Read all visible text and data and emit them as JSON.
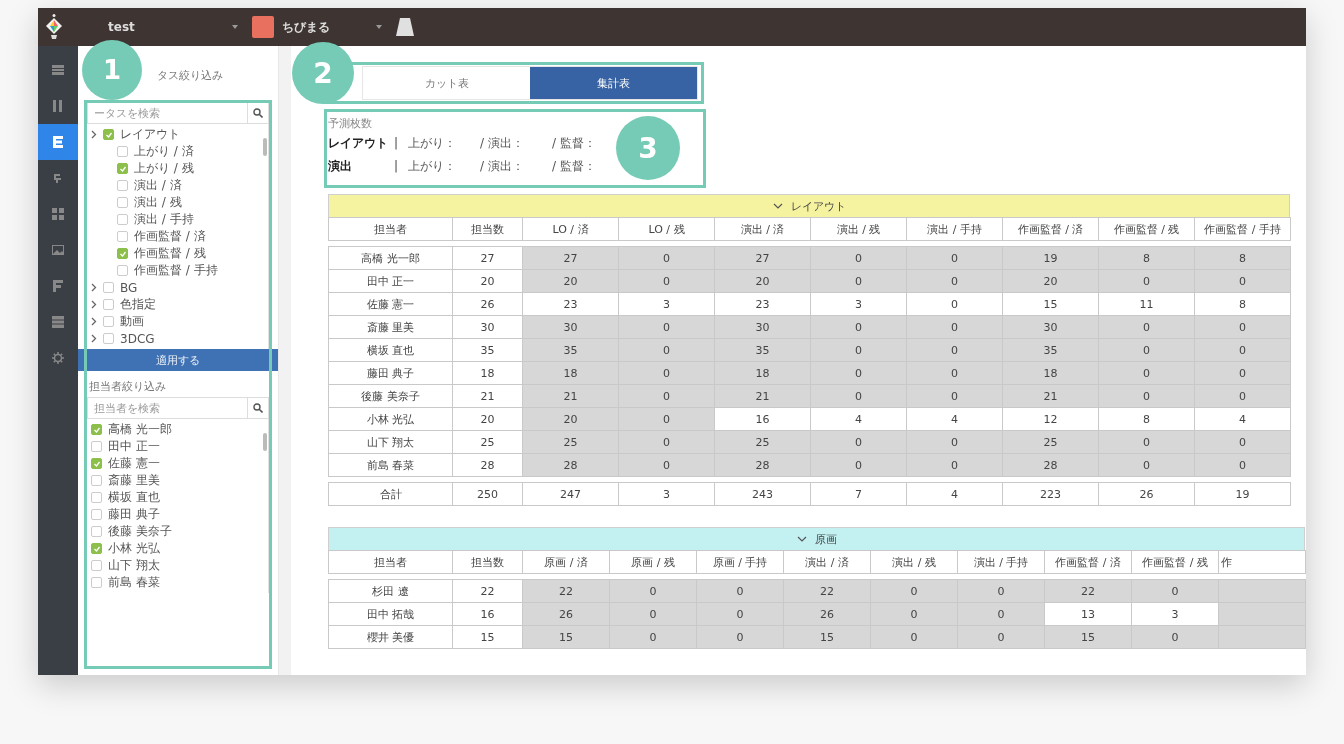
{
  "topbar": {
    "project": "test",
    "episode": "ちびまる"
  },
  "rail": [
    {
      "kind": "list",
      "selected": false
    },
    {
      "kind": "columns",
      "selected": false
    },
    {
      "kind": "sheet",
      "selected": true
    },
    {
      "kind": "steps",
      "selected": false
    },
    {
      "kind": "grid",
      "selected": false
    },
    {
      "kind": "image",
      "selected": false
    },
    {
      "kind": "flag",
      "selected": false
    },
    {
      "kind": "table",
      "selected": false
    },
    {
      "kind": "gear",
      "selected": false
    }
  ],
  "status_filter": {
    "callout": "1",
    "title": "タス絞り込み",
    "search_placeholder": "ータスを検索",
    "items": [
      {
        "label": "レイアウト",
        "checked": true,
        "children": [
          {
            "label": "上がり / 済",
            "checked": false
          },
          {
            "label": "上がり / 残",
            "checked": true
          },
          {
            "label": "演出 / 済",
            "checked": false
          },
          {
            "label": "演出 / 残",
            "checked": false
          },
          {
            "label": "演出 / 手持",
            "checked": false
          },
          {
            "label": "作画監督 / 済",
            "checked": false
          },
          {
            "label": "作画監督 / 残",
            "checked": true
          },
          {
            "label": "作画監督 / 手持",
            "checked": false
          }
        ]
      },
      {
        "label": "BG",
        "checked": false
      },
      {
        "label": "色指定",
        "checked": false
      },
      {
        "label": "動画",
        "checked": false
      },
      {
        "label": "3DCG",
        "checked": false
      }
    ],
    "apply_button": "適用する"
  },
  "person_filter": {
    "title": "担当者絞り込み",
    "search_placeholder": "担当者を検索",
    "people": [
      {
        "name": "高橋 光一郎",
        "checked": true
      },
      {
        "name": "田中 正一",
        "checked": false
      },
      {
        "name": "佐藤 憲一",
        "checked": true
      },
      {
        "name": "斎藤 里美",
        "checked": false
      },
      {
        "name": "横坂 直也",
        "checked": false
      },
      {
        "name": "藤田 典子",
        "checked": false
      },
      {
        "name": "後藤 美奈子",
        "checked": false
      },
      {
        "name": "小林 光弘",
        "checked": true
      },
      {
        "name": "山下 翔太",
        "checked": false
      },
      {
        "name": "前島 春菜",
        "checked": false
      }
    ]
  },
  "view_tabs": {
    "callout": "2",
    "tabs": [
      {
        "label": "カット表",
        "selected": false
      },
      {
        "label": "集計表",
        "selected": true
      }
    ]
  },
  "forecast": {
    "callout": "3",
    "title": "予測枚数",
    "rows": [
      {
        "label": "レイアウト",
        "separator": "|",
        "fields": [
          "上がり：",
          "/ 演出：",
          "/ 監督："
        ]
      },
      {
        "label": "演出",
        "separator": "|",
        "fields": [
          "上がり：",
          "/ 演出：",
          "/ 監督："
        ]
      }
    ]
  },
  "tables": [
    {
      "title": "レイアウト",
      "color": "#f6f3a0",
      "columns": [
        "担当者",
        "担当数",
        "LO / 済",
        "LO / 残",
        "演出 / 済",
        "演出 / 残",
        "演出 / 手持",
        "作画監督 / 済",
        "作画監督 / 残",
        "作画監督 / 手持"
      ],
      "rows": [
        {
          "cells": [
            {
              "value": "高橋 光一郎",
              "shaded": false
            },
            {
              "value": "27",
              "shaded": false
            },
            {
              "value": "27",
              "shaded": true
            },
            {
              "value": "0",
              "shaded": true
            },
            {
              "value": "27",
              "shaded": true
            },
            {
              "value": "0",
              "shaded": true
            },
            {
              "value": "0",
              "shaded": true
            },
            {
              "value": "19",
              "shaded": true
            },
            {
              "value": "8",
              "shaded": true
            },
            {
              "value": "8",
              "shaded": true
            }
          ]
        },
        {
          "cells": [
            {
              "value": "田中 正一",
              "shaded": false
            },
            {
              "value": "20",
              "shaded": false
            },
            {
              "value": "20",
              "shaded": true
            },
            {
              "value": "0",
              "shaded": true
            },
            {
              "value": "20",
              "shaded": true
            },
            {
              "value": "0",
              "shaded": true
            },
            {
              "value": "0",
              "shaded": true
            },
            {
              "value": "20",
              "shaded": true
            },
            {
              "value": "0",
              "shaded": true
            },
            {
              "value": "0",
              "shaded": true
            }
          ]
        },
        {
          "cells": [
            {
              "value": "佐藤 憲一",
              "shaded": false
            },
            {
              "value": "26",
              "shaded": false
            },
            {
              "value": "23",
              "shaded": false
            },
            {
              "value": "3",
              "shaded": false
            },
            {
              "value": "23",
              "shaded": false
            },
            {
              "value": "3",
              "shaded": false
            },
            {
              "value": "0",
              "shaded": false
            },
            {
              "value": "15",
              "shaded": false
            },
            {
              "value": "11",
              "shaded": false
            },
            {
              "value": "8",
              "shaded": false
            }
          ]
        },
        {
          "cells": [
            {
              "value": "斎藤 里美",
              "shaded": false
            },
            {
              "value": "30",
              "shaded": false
            },
            {
              "value": "30",
              "shaded": true
            },
            {
              "value": "0",
              "shaded": true
            },
            {
              "value": "30",
              "shaded": true
            },
            {
              "value": "0",
              "shaded": true
            },
            {
              "value": "0",
              "shaded": true
            },
            {
              "value": "30",
              "shaded": true
            },
            {
              "value": "0",
              "shaded": true
            },
            {
              "value": "0",
              "shaded": true
            }
          ]
        },
        {
          "cells": [
            {
              "value": "横坂 直也",
              "shaded": false
            },
            {
              "value": "35",
              "shaded": false
            },
            {
              "value": "35",
              "shaded": true
            },
            {
              "value": "0",
              "shaded": true
            },
            {
              "value": "35",
              "shaded": true
            },
            {
              "value": "0",
              "shaded": true
            },
            {
              "value": "0",
              "shaded": true
            },
            {
              "value": "35",
              "shaded": true
            },
            {
              "value": "0",
              "shaded": true
            },
            {
              "value": "0",
              "shaded": true
            }
          ]
        },
        {
          "cells": [
            {
              "value": "藤田 典子",
              "shaded": false
            },
            {
              "value": "18",
              "shaded": false
            },
            {
              "value": "18",
              "shaded": true
            },
            {
              "value": "0",
              "shaded": true
            },
            {
              "value": "18",
              "shaded": true
            },
            {
              "value": "0",
              "shaded": true
            },
            {
              "value": "0",
              "shaded": true
            },
            {
              "value": "18",
              "shaded": true
            },
            {
              "value": "0",
              "shaded": true
            },
            {
              "value": "0",
              "shaded": true
            }
          ]
        },
        {
          "cells": [
            {
              "value": "後藤 美奈子",
              "shaded": false
            },
            {
              "value": "21",
              "shaded": false
            },
            {
              "value": "21",
              "shaded": true
            },
            {
              "value": "0",
              "shaded": true
            },
            {
              "value": "21",
              "shaded": true
            },
            {
              "value": "0",
              "shaded": true
            },
            {
              "value": "0",
              "shaded": true
            },
            {
              "value": "21",
              "shaded": true
            },
            {
              "value": "0",
              "shaded": true
            },
            {
              "value": "0",
              "shaded": true
            }
          ]
        },
        {
          "cells": [
            {
              "value": "小林 光弘",
              "shaded": false
            },
            {
              "value": "20",
              "shaded": false
            },
            {
              "value": "20",
              "shaded": true
            },
            {
              "value": "0",
              "shaded": true
            },
            {
              "value": "16",
              "shaded": false
            },
            {
              "value": "4",
              "shaded": false
            },
            {
              "value": "4",
              "shaded": false
            },
            {
              "value": "12",
              "shaded": false
            },
            {
              "value": "8",
              "shaded": false
            },
            {
              "value": "4",
              "shaded": false
            }
          ]
        },
        {
          "cells": [
            {
              "value": "山下 翔太",
              "shaded": false
            },
            {
              "value": "25",
              "shaded": false
            },
            {
              "value": "25",
              "shaded": true
            },
            {
              "value": "0",
              "shaded": true
            },
            {
              "value": "25",
              "shaded": true
            },
            {
              "value": "0",
              "shaded": true
            },
            {
              "value": "0",
              "shaded": true
            },
            {
              "value": "25",
              "shaded": true
            },
            {
              "value": "0",
              "shaded": true
            },
            {
              "value": "0",
              "shaded": true
            }
          ]
        },
        {
          "cells": [
            {
              "value": "前島 春菜",
              "shaded": false
            },
            {
              "value": "28",
              "shaded": false
            },
            {
              "value": "28",
              "shaded": true
            },
            {
              "value": "0",
              "shaded": true
            },
            {
              "value": "28",
              "shaded": true
            },
            {
              "value": "0",
              "shaded": true
            },
            {
              "value": "0",
              "shaded": true
            },
            {
              "value": "28",
              "shaded": true
            },
            {
              "value": "0",
              "shaded": true
            },
            {
              "value": "0",
              "shaded": true
            }
          ]
        }
      ],
      "total": [
        "合計",
        "250",
        "247",
        "3",
        "243",
        "7",
        "4",
        "223",
        "26",
        "19"
      ]
    },
    {
      "title": "原画",
      "color": "#c3f0f1",
      "columns": [
        "担当者",
        "担当数",
        "原画 / 済",
        "原画 / 残",
        "原画 / 手持",
        "演出 / 済",
        "演出 / 残",
        "演出 / 手持",
        "作画監督 / 済",
        "作画監督 / 残",
        "作"
      ],
      "rows": [
        {
          "cells": [
            {
              "value": "杉田 遼",
              "shaded": false
            },
            {
              "value": "22",
              "shaded": false
            },
            {
              "value": "22",
              "shaded": true
            },
            {
              "value": "0",
              "shaded": true
            },
            {
              "value": "0",
              "shaded": true
            },
            {
              "value": "22",
              "shaded": true
            },
            {
              "value": "0",
              "shaded": true
            },
            {
              "value": "0",
              "shaded": true
            },
            {
              "value": "22",
              "shaded": true
            },
            {
              "value": "0",
              "shaded": true
            }
          ]
        },
        {
          "cells": [
            {
              "value": "田中 拓哉",
              "shaded": false
            },
            {
              "value": "16",
              "shaded": false
            },
            {
              "value": "26",
              "shaded": true
            },
            {
              "value": "0",
              "shaded": true
            },
            {
              "value": "0",
              "shaded": true
            },
            {
              "value": "26",
              "shaded": true
            },
            {
              "value": "0",
              "shaded": true
            },
            {
              "value": "0",
              "shaded": true
            },
            {
              "value": "13",
              "shaded": false
            },
            {
              "value": "3",
              "shaded": false
            }
          ]
        },
        {
          "cells": [
            {
              "value": "櫻井 美優",
              "shaded": false
            },
            {
              "value": "15",
              "shaded": false
            },
            {
              "value": "15",
              "shaded": true
            },
            {
              "value": "0",
              "shaded": true
            },
            {
              "value": "0",
              "shaded": true
            },
            {
              "value": "15",
              "shaded": true
            },
            {
              "value": "0",
              "shaded": true
            },
            {
              "value": "0",
              "shaded": true
            },
            {
              "value": "15",
              "shaded": true
            },
            {
              "value": "0",
              "shaded": true
            }
          ]
        }
      ]
    }
  ]
}
